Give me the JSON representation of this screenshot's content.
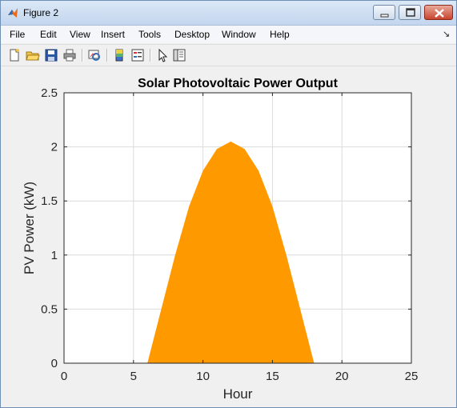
{
  "window": {
    "title": "Figure 2"
  },
  "menu": [
    "File",
    "Edit",
    "View",
    "Insert",
    "Tools",
    "Desktop",
    "Window",
    "Help"
  ],
  "menu_overflow_glyph": "↘",
  "toolbar_icons": [
    "new-figure-icon",
    "open-file-icon",
    "save-icon",
    "print-icon",
    "link-plot-icon",
    "insert-colorbar-icon",
    "insert-legend-icon",
    "edit-plot-arrow-icon",
    "property-inspector-icon"
  ],
  "colors": {
    "fill": "#ff9900",
    "grid": "#dcdcdc",
    "axes_bg": "#ffffff"
  },
  "chart_data": {
    "type": "area",
    "title": "Solar Photovoltaic Power Output",
    "xlabel": "Hour",
    "ylabel": "PV Power (kW)",
    "xlim": [
      0,
      25
    ],
    "ylim": [
      0,
      2.5
    ],
    "xticks": [
      0,
      5,
      10,
      15,
      20,
      25
    ],
    "yticks": [
      0,
      0.5,
      1,
      1.5,
      2,
      2.5
    ],
    "grid": true,
    "x": [
      0,
      1,
      2,
      3,
      4,
      5,
      6,
      7,
      8,
      9,
      10,
      11,
      12,
      13,
      14,
      15,
      16,
      17,
      18,
      19,
      20,
      21,
      22,
      23,
      24
    ],
    "y": [
      0,
      0,
      0,
      0,
      0,
      0,
      0,
      0.5,
      1.0,
      1.45,
      1.78,
      1.98,
      2.05,
      1.98,
      1.78,
      1.45,
      1.0,
      0.5,
      0,
      0,
      0,
      0,
      0,
      0,
      0
    ]
  }
}
